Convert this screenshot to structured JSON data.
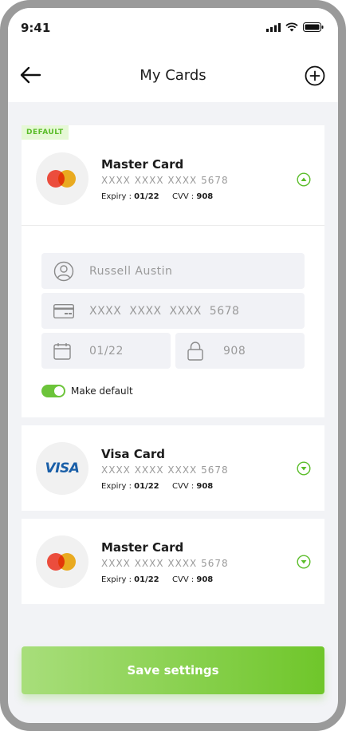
{
  "status_bar": {
    "time": "9:41"
  },
  "header": {
    "title": "My Cards"
  },
  "cards": [
    {
      "badge": "DEFAULT",
      "name": "Master Card",
      "number": "XXXX  XXXX  XXXX  5678",
      "expiry_label": "Expiry : ",
      "expiry_value": "01/22",
      "cvv_label": "CVV : ",
      "cvv_value": "908",
      "expanded": true
    },
    {
      "logo_text": "VISA",
      "name": "Visa Card",
      "number": "XXXX  XXXX  XXXX  5678",
      "expiry_label": "Expiry : ",
      "expiry_value": "01/22",
      "cvv_label": "CVV : ",
      "cvv_value": "908",
      "expanded": false
    },
    {
      "name": "Master Card",
      "number": "XXXX  XXXX  XXXX  5678",
      "expiry_label": "Expiry : ",
      "expiry_value": "01/22",
      "cvv_label": "CVV : ",
      "cvv_value": "908",
      "expanded": false
    }
  ],
  "form": {
    "holder_name": "Russell Austin",
    "card_number": "XXXX  XXXX  XXXX  5678",
    "expiry": "01/22",
    "cvv": "908",
    "make_default_label": "Make default",
    "make_default_on": true
  },
  "save_button": {
    "label": "Save settings"
  },
  "colors": {
    "accent": "#6cc43a",
    "badge_bg": "#e6f8d6",
    "mastercard_red": "#eb4d3d",
    "mastercard_yellow": "#f7b015",
    "visa_blue": "#1a5fa8"
  }
}
